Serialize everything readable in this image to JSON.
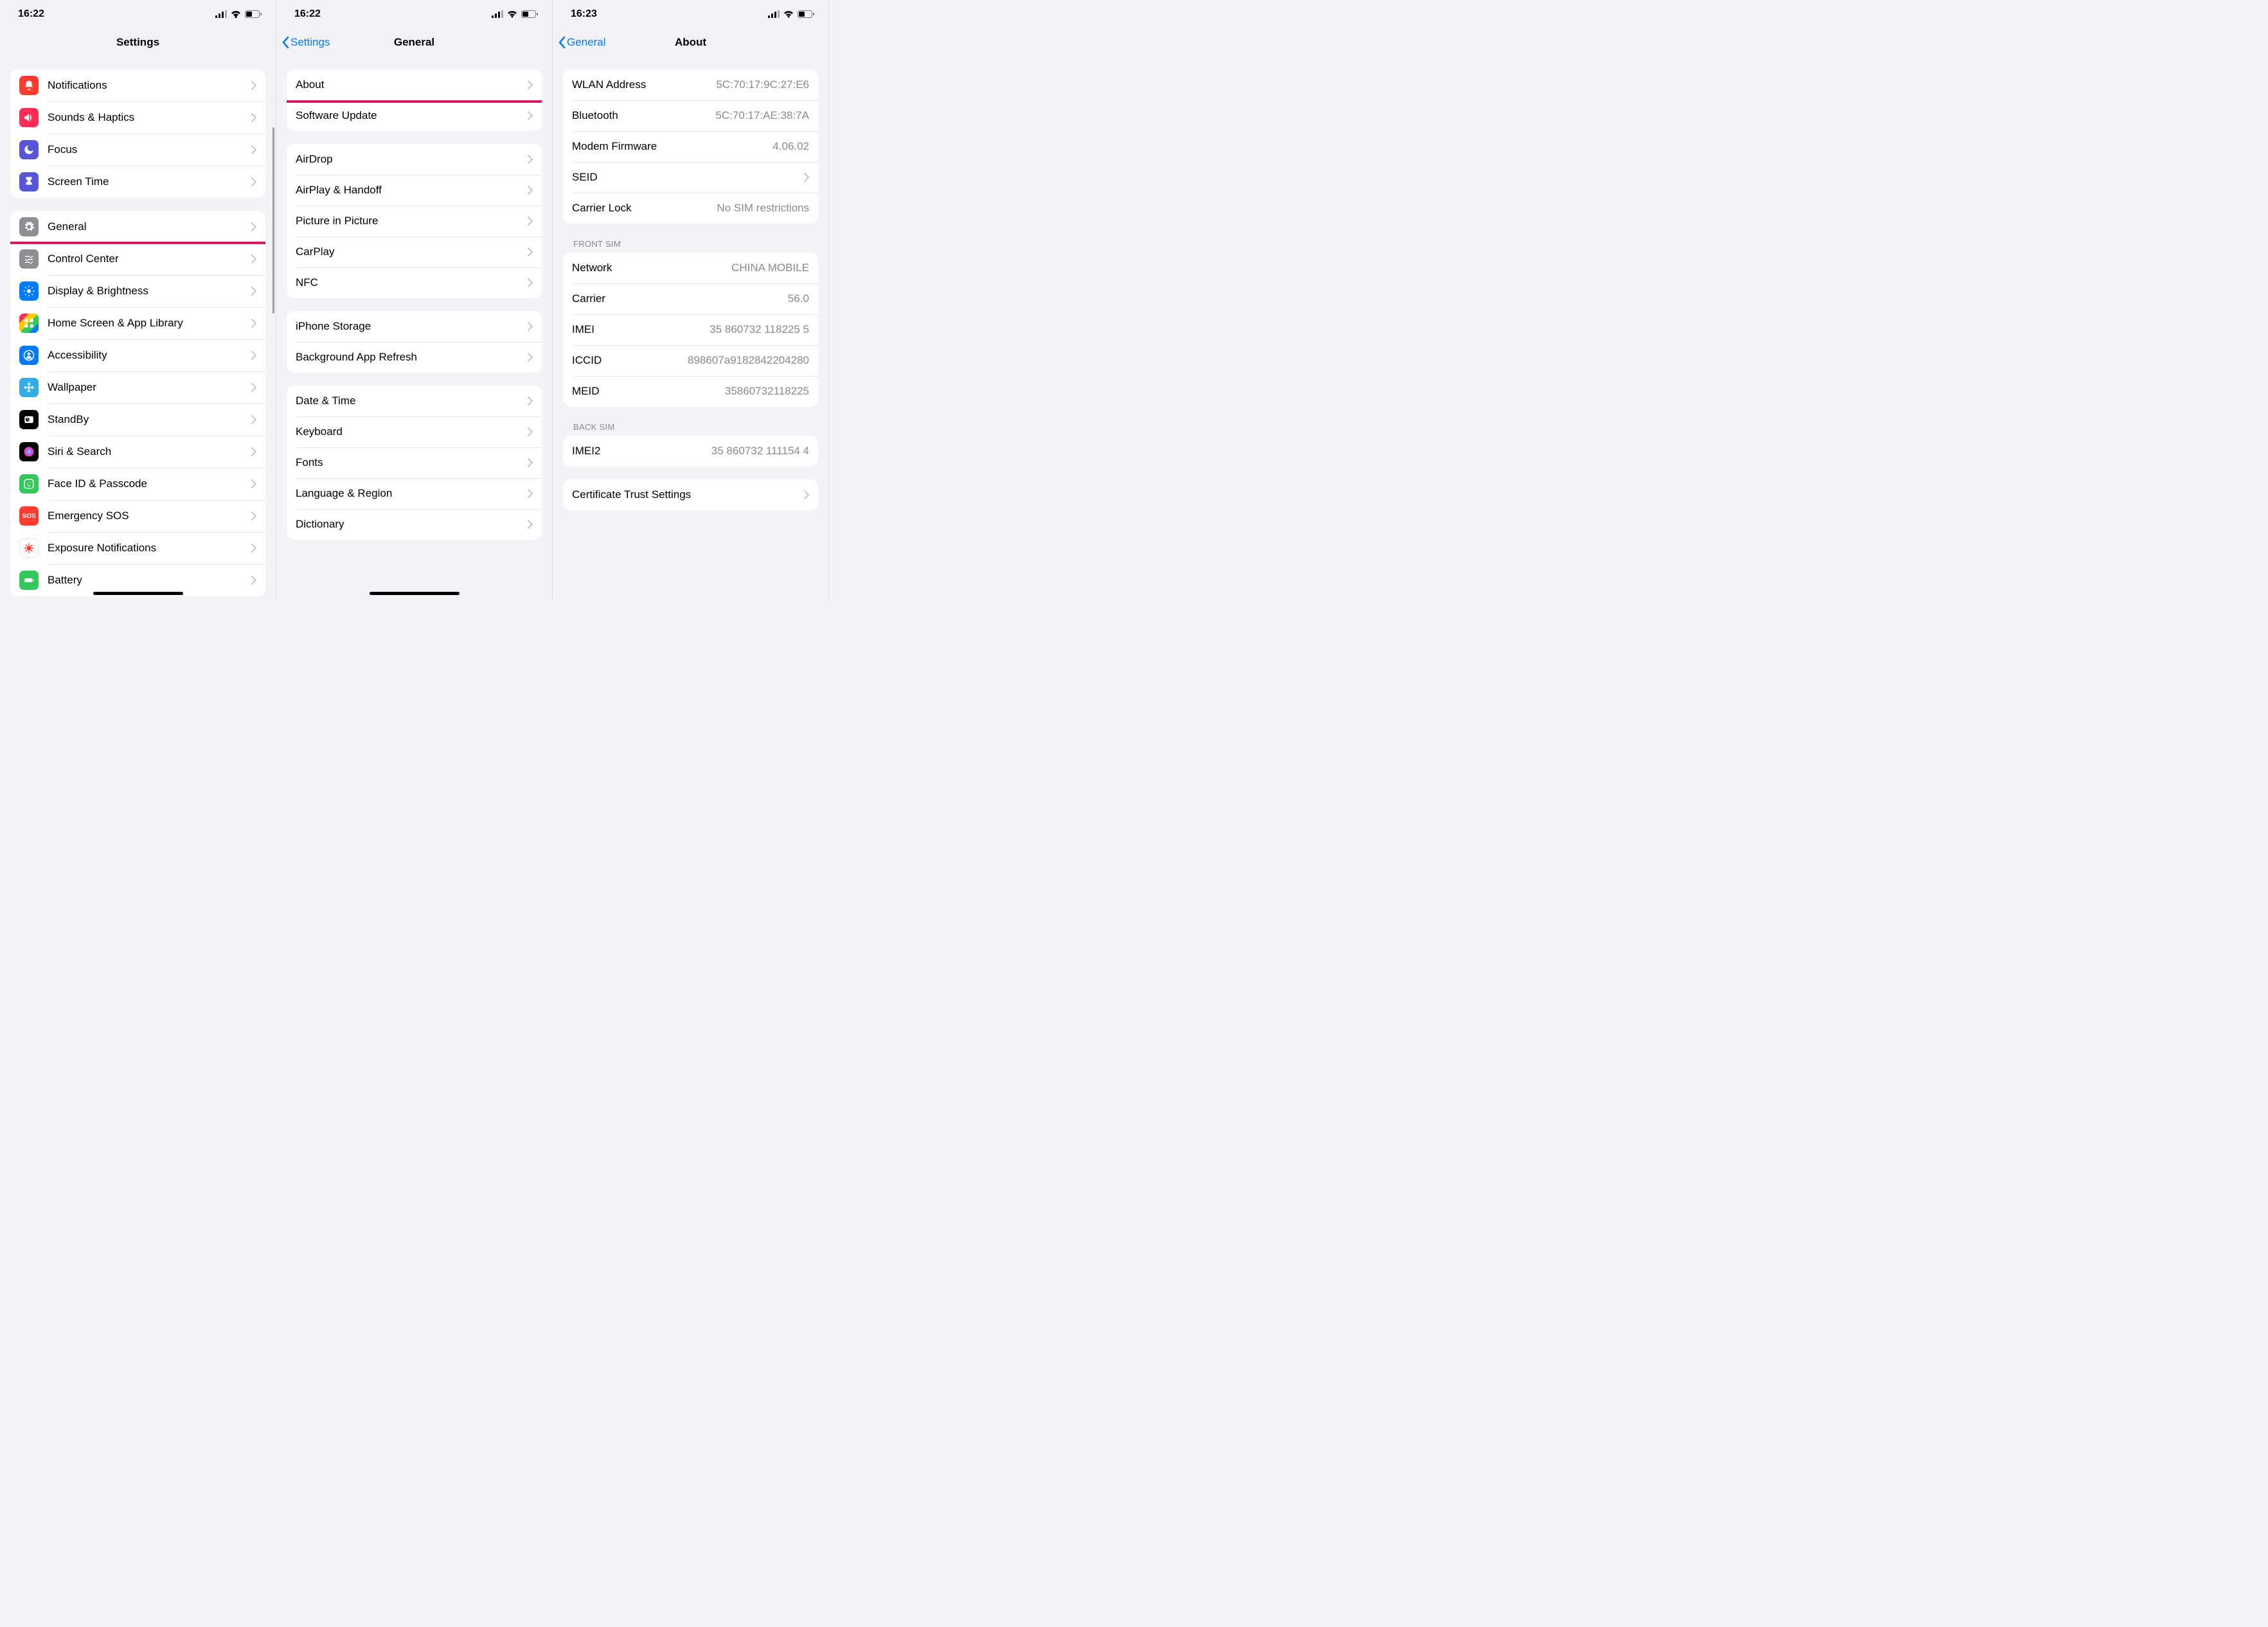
{
  "screen1": {
    "time": "16:22",
    "nav_title": "Settings",
    "group1": [
      {
        "name": "notifications",
        "label": "Notifications",
        "iconClass": "red",
        "glyph": "bell"
      },
      {
        "name": "sounds",
        "label": "Sounds & Haptics",
        "iconClass": "pink",
        "glyph": "speaker"
      },
      {
        "name": "focus",
        "label": "Focus",
        "iconClass": "indigo",
        "glyph": "moon"
      },
      {
        "name": "screen-time",
        "label": "Screen Time",
        "iconClass": "indigo",
        "glyph": "hourglass"
      }
    ],
    "group2": [
      {
        "name": "general",
        "label": "General",
        "iconClass": "gray",
        "glyph": "gear",
        "highlight": true
      },
      {
        "name": "control-center",
        "label": "Control Center",
        "iconClass": "gray",
        "glyph": "sliders"
      },
      {
        "name": "display",
        "label": "Display & Brightness",
        "iconClass": "blue",
        "glyph": "sun"
      },
      {
        "name": "home-screen",
        "label": "Home Screen & App Library",
        "iconClass": "multi",
        "glyph": "grid"
      },
      {
        "name": "accessibility",
        "label": "Accessibility",
        "iconClass": "blue",
        "glyph": "person"
      },
      {
        "name": "wallpaper",
        "label": "Wallpaper",
        "iconClass": "cyan",
        "glyph": "flower"
      },
      {
        "name": "standby",
        "label": "StandBy",
        "iconClass": "black",
        "glyph": "clock"
      },
      {
        "name": "siri",
        "label": "Siri & Search",
        "iconClass": "black",
        "glyph": "siri"
      },
      {
        "name": "faceid",
        "label": "Face ID & Passcode",
        "iconClass": "green",
        "glyph": "face"
      },
      {
        "name": "sos",
        "label": "Emergency SOS",
        "iconClass": "sos",
        "glyph": "SOS"
      },
      {
        "name": "exposure",
        "label": "Exposure Notifications",
        "iconClass": "white",
        "glyph": "virus"
      },
      {
        "name": "battery",
        "label": "Battery",
        "iconClass": "green",
        "glyph": "battery"
      }
    ]
  },
  "screen2": {
    "time": "16:22",
    "back_label": "Settings",
    "nav_title": "General",
    "group1": [
      {
        "name": "about",
        "label": "About",
        "highlight": true
      },
      {
        "name": "software-update",
        "label": "Software Update"
      }
    ],
    "group2": [
      {
        "name": "airdrop",
        "label": "AirDrop"
      },
      {
        "name": "airplay",
        "label": "AirPlay & Handoff"
      },
      {
        "name": "pip",
        "label": "Picture in Picture"
      },
      {
        "name": "carplay",
        "label": "CarPlay"
      },
      {
        "name": "nfc",
        "label": "NFC"
      }
    ],
    "group3": [
      {
        "name": "storage",
        "label": "iPhone Storage"
      },
      {
        "name": "bg-refresh",
        "label": "Background App Refresh"
      }
    ],
    "group4": [
      {
        "name": "date-time",
        "label": "Date & Time"
      },
      {
        "name": "keyboard",
        "label": "Keyboard"
      },
      {
        "name": "fonts",
        "label": "Fonts"
      },
      {
        "name": "language",
        "label": "Language & Region"
      },
      {
        "name": "dictionary",
        "label": "Dictionary"
      }
    ]
  },
  "screen3": {
    "time": "16:23",
    "back_label": "General",
    "nav_title": "About",
    "group1": [
      {
        "name": "wlan",
        "label": "WLAN Address",
        "value": "5C:70:17:9C:27:E6"
      },
      {
        "name": "bluetooth",
        "label": "Bluetooth",
        "value": "5C:70:17:AE:38:7A"
      },
      {
        "name": "modem",
        "label": "Modem Firmware",
        "value": "4.06.02"
      },
      {
        "name": "seid",
        "label": "SEID",
        "chevron": true
      },
      {
        "name": "carrier-lock",
        "label": "Carrier Lock",
        "value": "No SIM restrictions"
      }
    ],
    "group2_header": "FRONT SIM",
    "group2": [
      {
        "name": "network",
        "label": "Network",
        "value": "CHINA MOBILE"
      },
      {
        "name": "carrier",
        "label": "Carrier",
        "value": "56.0"
      },
      {
        "name": "imei",
        "label": "IMEI",
        "value": "35 860732 118225 5"
      },
      {
        "name": "iccid",
        "label": "ICCID",
        "value": "898607a9182842204280"
      },
      {
        "name": "meid",
        "label": "MEID",
        "value": "35860732118225"
      }
    ],
    "group3_header": "BACK SIM",
    "group3": [
      {
        "name": "imei2",
        "label": "IMEI2",
        "value": "35 860732 111154 4"
      }
    ],
    "group4": [
      {
        "name": "cert-trust",
        "label": "Certificate Trust Settings",
        "chevron": true
      }
    ]
  }
}
